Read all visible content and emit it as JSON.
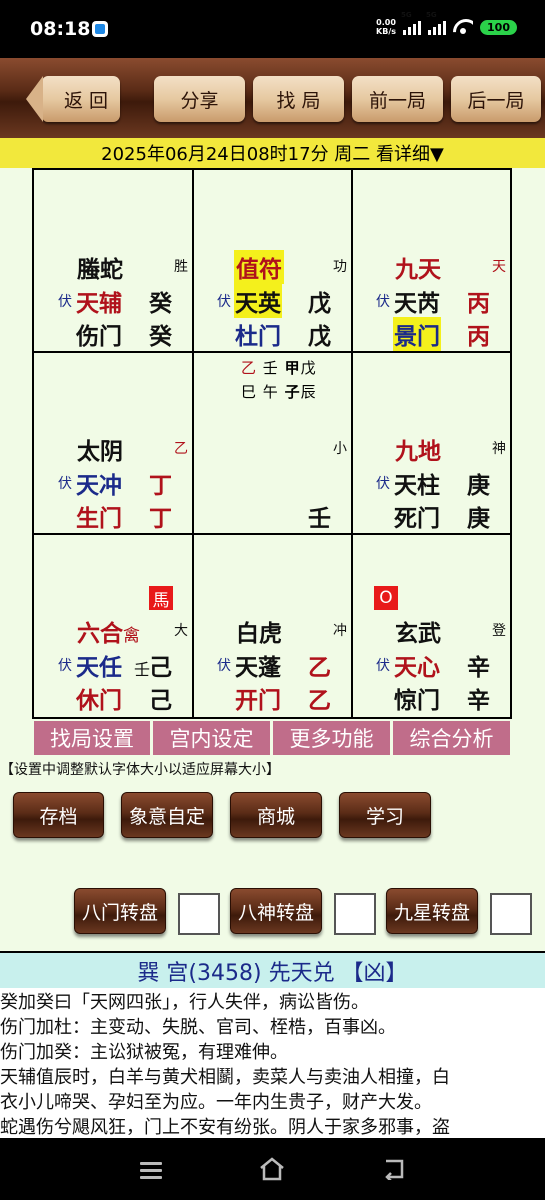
{
  "status": {
    "time": "08:18",
    "speed_top": "0.00",
    "speed_unit": "KB/s",
    "net1": "5G",
    "net2": "5G",
    "battery": "100"
  },
  "toolbar": {
    "back": "返 回",
    "share": "分享",
    "find": "找 局",
    "prev": "前一局",
    "next": "后一局"
  },
  "date_line": "2025年06月24日08时17分 周二 看详细▼",
  "palaces": {
    "p1": {
      "god": "螣蛇",
      "tag": "胜",
      "fu": "伏",
      "star": "天辅",
      "gan1": "癸",
      "door": "伤门",
      "gan2": "癸"
    },
    "p2": {
      "god": "值符",
      "tag": "功",
      "fu": "伏",
      "star": "天英",
      "gan1": "戊",
      "door": "杜门",
      "gan2": "戊"
    },
    "p3": {
      "god": "九天",
      "tag": "天",
      "fu": "伏",
      "star": "天芮",
      "gan1": "丙",
      "door": "景门",
      "gan2": "丙"
    },
    "p4": {
      "god": "太阴",
      "tag": "乙",
      "fu": "伏",
      "star": "天冲",
      "gan1": "丁",
      "door": "生门",
      "gan2": "丁"
    },
    "p5": {
      "line1a": "乙",
      "line1b": "壬",
      "line1c": "甲",
      "line1d": "戊",
      "line2a": "巳",
      "line2b": "午",
      "line2c": "子",
      "line2d": "辰",
      "tag": "小",
      "gan2": "壬"
    },
    "p6": {
      "god": "九地",
      "tag": "神",
      "fu": "伏",
      "star": "天柱",
      "gan1": "庚",
      "door": "死门",
      "gan2": "庚"
    },
    "p7": {
      "marker": "馬",
      "god": "六合",
      "god_suffix": "禽",
      "tag": "大",
      "fu": "伏",
      "star": "天任",
      "small": "壬",
      "gan1": "己",
      "door": "休门",
      "gan2": "己"
    },
    "p8": {
      "god": "白虎",
      "tag": "冲",
      "fu": "伏",
      "star": "天蓬",
      "gan1": "乙",
      "door": "开门",
      "gan2": "乙"
    },
    "p9": {
      "marker": "O",
      "god": "玄武",
      "tag": "登",
      "fu": "伏",
      "star": "天心",
      "gan1": "辛",
      "door": "惊门",
      "gan2": "辛"
    }
  },
  "menu": [
    "找局设置",
    "宫内设定",
    "更多功能",
    "综合分析"
  ],
  "hint": "【设置中调整默认字体大小以适应屏幕大小】",
  "buttons": {
    "save": "存档",
    "custom": "象意自定",
    "shop": "商城",
    "learn": "学习",
    "door_rotate": "八门转盘",
    "god_rotate": "八神转盘",
    "star_rotate": "九星转盘"
  },
  "info": {
    "title": "巽 宫(3458) 先天兑 【凶】",
    "lines": [
      "癸加癸曰「天网四张」，行人失伴，病讼皆伤。",
      "伤门加杜：主变动、失脱、官司、桎梏，百事凶。",
      "伤门加癸：主讼狱被冤，有理难伸。",
      "天辅值辰时，白羊与黄犬相鬬，卖菜人与卖油人相撞，白",
      "衣小儿啼哭、孕妇至为应。一年内生贵子，财产大发。",
      "蛇遇伤兮飓风狂，门上不安有纷张。阴人于家多邪事，盗"
    ]
  },
  "colors": {
    "accent_yellow": "#f2e83c",
    "menu_pink": "#c06d8a",
    "brown": "#5b2c17",
    "red_text": "#b0121b",
    "blue_text": "#1b2a8a"
  }
}
